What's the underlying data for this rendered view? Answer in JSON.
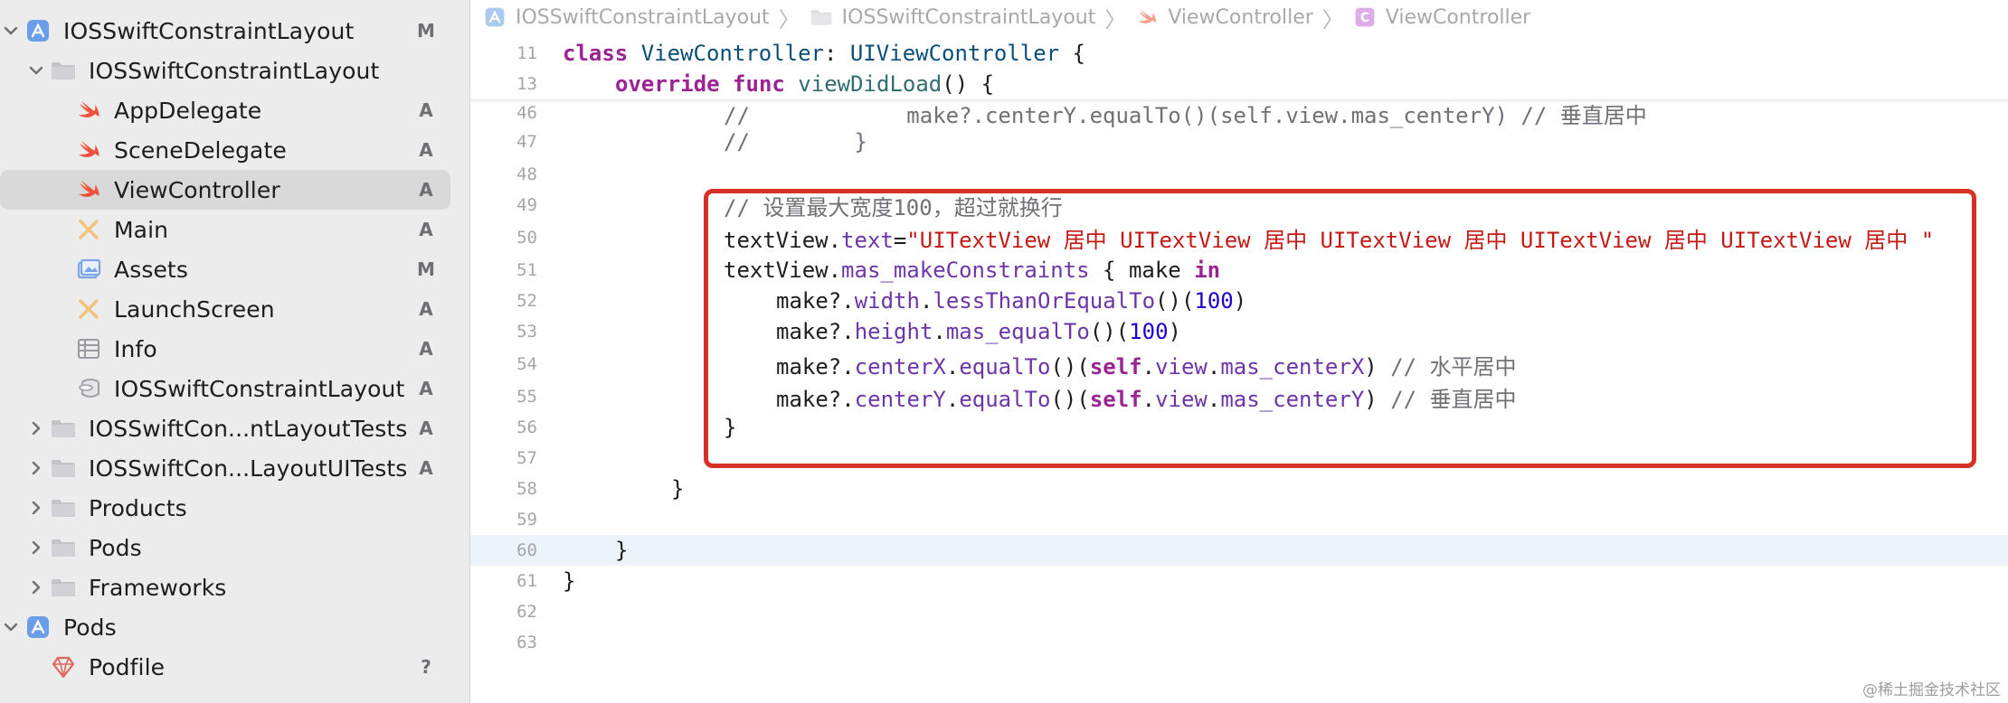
{
  "sidebar": {
    "rows": [
      {
        "label": "IOSSwiftConstraintLayout",
        "icon": "xcode-project-icon",
        "chevron": "down",
        "badge": "M"
      },
      {
        "label": "IOSSwiftConstraintLayout",
        "icon": "folder-icon",
        "chevron": "down",
        "badge": ""
      },
      {
        "label": "AppDelegate",
        "icon": "swift-file-icon",
        "chevron": "",
        "badge": "A"
      },
      {
        "label": "SceneDelegate",
        "icon": "swift-file-icon",
        "chevron": "",
        "badge": "A"
      },
      {
        "label": "ViewController",
        "icon": "swift-file-icon",
        "chevron": "",
        "badge": "A",
        "selected": true
      },
      {
        "label": "Main",
        "icon": "storyboard-icon",
        "chevron": "",
        "badge": "A"
      },
      {
        "label": "Assets",
        "icon": "asset-catalog-icon",
        "chevron": "",
        "badge": "M"
      },
      {
        "label": "LaunchScreen",
        "icon": "storyboard-icon",
        "chevron": "",
        "badge": "A"
      },
      {
        "label": "Info",
        "icon": "plist-icon",
        "chevron": "",
        "badge": "A"
      },
      {
        "label": "IOSSwiftConstraintLayout",
        "icon": "xcdatamodel-icon",
        "chevron": "",
        "badge": "A"
      },
      {
        "label": "IOSSwiftCon...ntLayoutTests",
        "icon": "folder-icon",
        "chevron": "right",
        "badge": "A"
      },
      {
        "label": "IOSSwiftCon...LayoutUITests",
        "icon": "folder-icon",
        "chevron": "right",
        "badge": "A"
      },
      {
        "label": "Products",
        "icon": "folder-icon",
        "chevron": "right",
        "badge": ""
      },
      {
        "label": "Pods",
        "icon": "folder-icon",
        "chevron": "right",
        "badge": ""
      },
      {
        "label": "Frameworks",
        "icon": "folder-icon",
        "chevron": "right",
        "badge": ""
      },
      {
        "label": "Pods",
        "icon": "xcode-project-icon",
        "chevron": "down",
        "badge": ""
      },
      {
        "label": "Podfile",
        "icon": "podfile-icon",
        "chevron": "",
        "badge": "?"
      }
    ]
  },
  "breadcrumb": {
    "items": [
      {
        "label": "IOSSwiftConstraintLayout",
        "icon": "xcode-project-icon"
      },
      {
        "label": "IOSSwiftConstraintLayout",
        "icon": "folder-icon"
      },
      {
        "label": "ViewController",
        "icon": "swift-file-icon"
      },
      {
        "label": "ViewController",
        "icon": "class-icon"
      }
    ]
  },
  "code": {
    "lines": [
      {
        "num": "11",
        "tokens": [
          [
            "kw",
            "class"
          ],
          [
            "",
            "  "
          ],
          [
            "ty",
            "ViewController"
          ],
          [
            "",
            ": "
          ],
          [
            "ty",
            "UIViewController"
          ],
          [
            "",
            {
              "__": "x"
            }
          ]
        ]
      },
      {
        "num": "13",
        "text": ""
      },
      {
        "num": "46",
        "text": ""
      },
      {
        "num": "47",
        "text": ""
      },
      {
        "num": "48",
        "text": ""
      },
      {
        "num": "49",
        "text": ""
      },
      {
        "num": "50",
        "text": ""
      },
      {
        "num": "51",
        "text": ""
      },
      {
        "num": "52",
        "text": ""
      },
      {
        "num": "53",
        "text": ""
      },
      {
        "num": "54",
        "text": ""
      },
      {
        "num": "55",
        "text": ""
      },
      {
        "num": "56",
        "text": ""
      },
      {
        "num": "57",
        "text": ""
      },
      {
        "num": "58",
        "text": ""
      },
      {
        "num": "59",
        "text": ""
      },
      {
        "num": "60",
        "text": ""
      },
      {
        "num": "61",
        "text": ""
      },
      {
        "num": "62",
        "text": ""
      },
      {
        "num": "63",
        "text": ""
      }
    ],
    "segments": {
      "l11": [
        [
          "kw",
          "class"
        ],
        [
          "",
          " "
        ],
        [
          "ty",
          "ViewController"
        ],
        [
          "",
          ": "
        ],
        [
          "ty",
          "UIViewController"
        ],
        [
          "",
          " {"
        ]
      ],
      "l13": [
        [
          "",
          ""
        ],
        [
          "kw",
          "override"
        ],
        [
          "",
          " "
        ],
        [
          "kw",
          "func"
        ],
        [
          "",
          " "
        ],
        [
          "fn",
          "viewDidLoad"
        ],
        [
          "",
          "() {"
        ]
      ],
      "l46": [
        [
          "cm",
          "//            make?.centerY.equalTo()(self.view.mas_centerY) // 垂直居中"
        ]
      ],
      "l47": [
        [
          "cm",
          "//        }"
        ]
      ],
      "l48": [],
      "l49": [
        [
          "cm",
          "// 设置最大宽度100，超过就换行"
        ]
      ],
      "l50": [
        [
          "",
          "textView."
        ],
        [
          "pr",
          "text"
        ],
        [
          "",
          "="
        ],
        [
          "str",
          "\"UITextView 居中 UITextView 居中 UITextView 居中 UITextView 居中 UITextView 居中 \""
        ]
      ],
      "l51": [
        [
          "",
          "textView."
        ],
        [
          "pr",
          "mas_makeConstraints"
        ],
        [
          "",
          " { make "
        ],
        [
          "kw",
          "in"
        ]
      ],
      "l52": [
        [
          "",
          "make?."
        ],
        [
          "pr",
          "width"
        ],
        [
          "",
          "."
        ],
        [
          "pr",
          "lessThanOrEqualTo"
        ],
        [
          "",
          "()("
        ],
        [
          "num",
          "100"
        ],
        [
          "",
          ")"
        ]
      ],
      "l53": [
        [
          "",
          "make?."
        ],
        [
          "pr",
          "height"
        ],
        [
          "",
          "."
        ],
        [
          "pr",
          "mas_equalTo"
        ],
        [
          "",
          "()("
        ],
        [
          "num",
          "100"
        ],
        [
          "",
          ")"
        ]
      ],
      "l54": [
        [
          "",
          "make?."
        ],
        [
          "pr",
          "centerX"
        ],
        [
          "",
          "."
        ],
        [
          "pr",
          "equalTo"
        ],
        [
          "",
          "()("
        ],
        [
          "kw",
          "self"
        ],
        [
          "",
          "."
        ],
        [
          "pr",
          "view"
        ],
        [
          "",
          "."
        ],
        [
          "pr",
          "mas_centerX"
        ],
        [
          "",
          ") "
        ],
        [
          "cm",
          "// 水平居中"
        ]
      ],
      "l55": [
        [
          "",
          "make?."
        ],
        [
          "pr",
          "centerY"
        ],
        [
          "",
          "."
        ],
        [
          "pr",
          "equalTo"
        ],
        [
          "",
          "()("
        ],
        [
          "kw",
          "self"
        ],
        [
          "",
          "."
        ],
        [
          "pr",
          "view"
        ],
        [
          "",
          "."
        ],
        [
          "pr",
          "mas_centerY"
        ],
        [
          "",
          ") "
        ],
        [
          "cm",
          "// 垂直居中"
        ]
      ],
      "l56": [
        [
          "",
          "}"
        ]
      ],
      "l57": [],
      "l58": [
        [
          "",
          "}"
        ]
      ],
      "l59": [],
      "l60": [
        [
          "",
          "}"
        ]
      ],
      "l61": [
        [
          "",
          "}"
        ]
      ],
      "l62": [],
      "l63": []
    }
  },
  "watermark": "@稀土掘金技术社区",
  "colors": {
    "accent_box": "#d93025",
    "keyword": "#9b2393",
    "string": "#c41a16",
    "number": "#1c00cf",
    "comment": "#707078",
    "property": "#6c36a9",
    "type": "#0b4f79",
    "function": "#326d74"
  }
}
